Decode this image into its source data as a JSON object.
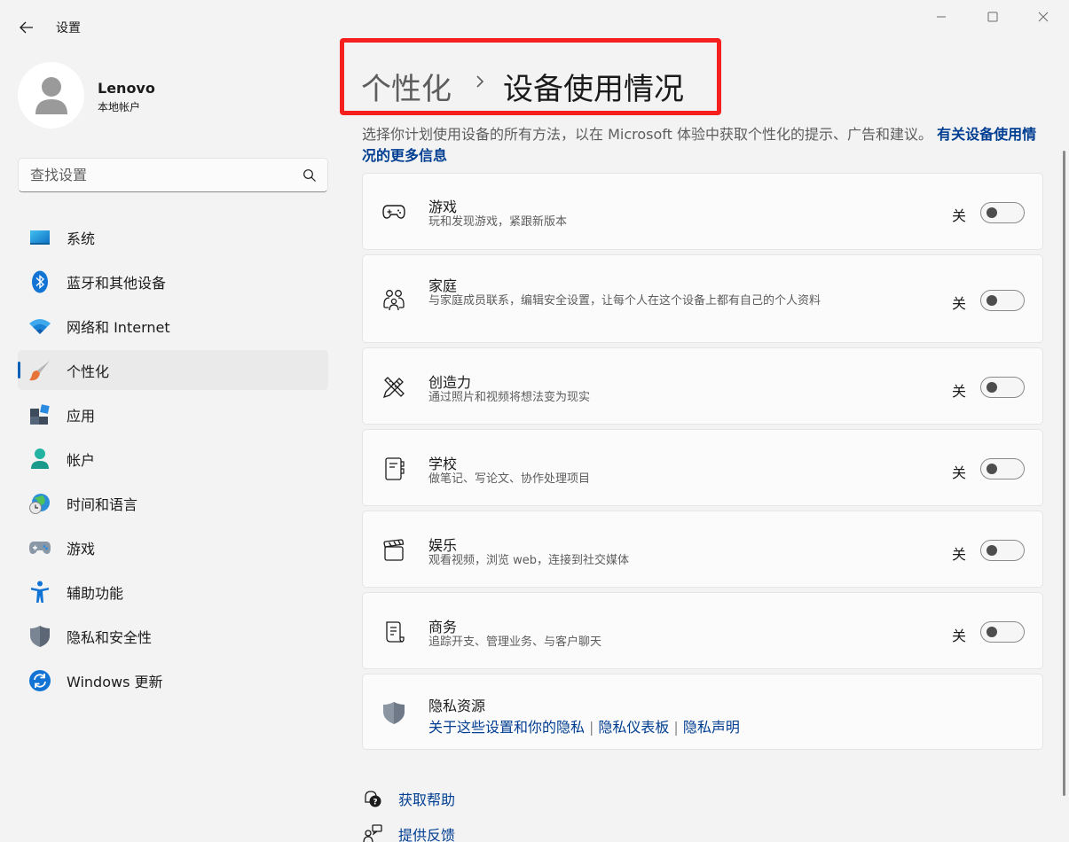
{
  "window": {
    "title": "设置"
  },
  "profile": {
    "name": "Lenovo",
    "account_type": "本地帐户"
  },
  "search": {
    "placeholder": "查找设置"
  },
  "nav": {
    "items": [
      {
        "label": "系统",
        "icon": "system-icon"
      },
      {
        "label": "蓝牙和其他设备",
        "icon": "bluetooth-icon"
      },
      {
        "label": "网络和 Internet",
        "icon": "wifi-icon"
      },
      {
        "label": "个性化",
        "icon": "brush-icon",
        "active": true
      },
      {
        "label": "应用",
        "icon": "apps-icon"
      },
      {
        "label": "帐户",
        "icon": "account-icon"
      },
      {
        "label": "时间和语言",
        "icon": "globe-clock-icon"
      },
      {
        "label": "游戏",
        "icon": "gamepad-icon"
      },
      {
        "label": "辅助功能",
        "icon": "accessibility-icon"
      },
      {
        "label": "隐私和安全性",
        "icon": "shield-icon"
      },
      {
        "label": "Windows 更新",
        "icon": "update-icon"
      }
    ]
  },
  "breadcrumb": {
    "parent": "个性化",
    "current": "设备使用情况"
  },
  "description": {
    "text": "选择你计划使用设备的所有方法，以在 Microsoft 体验中获取个性化的提示、广告和建议。",
    "link": "有关设备使用情况的更多信息"
  },
  "cards": [
    {
      "title": "游戏",
      "subtitle": "玩和发现游戏，紧跟新版本",
      "state": "关",
      "icon": "gamepad-icon"
    },
    {
      "title": "家庭",
      "subtitle": "与家庭成员联系，编辑安全设置，让每个人在这个设备上都有自己的个人资料",
      "state": "关",
      "icon": "family-icon"
    },
    {
      "title": "创造力",
      "subtitle": "通过照片和视频将想法变为现实",
      "state": "关",
      "icon": "pen-ruler-icon"
    },
    {
      "title": "学校",
      "subtitle": "做笔记、写论文、协作处理项目",
      "state": "关",
      "icon": "notebook-icon"
    },
    {
      "title": "娱乐",
      "subtitle": "观看视频，浏览 web，连接到社交媒体",
      "state": "关",
      "icon": "clapperboard-icon"
    },
    {
      "title": "商务",
      "subtitle": "追踪开支、管理业务、与客户聊天",
      "state": "关",
      "icon": "document-icon"
    }
  ],
  "privacy": {
    "title": "隐私资源",
    "links": [
      "关于这些设置和你的隐私",
      "隐私仪表板",
      "隐私声明"
    ]
  },
  "help": {
    "get_help": "获取帮助",
    "feedback": "提供反馈"
  },
  "colors": {
    "accent": "#005fb8",
    "link": "#003e92",
    "highlight_box": "#f5201e"
  }
}
